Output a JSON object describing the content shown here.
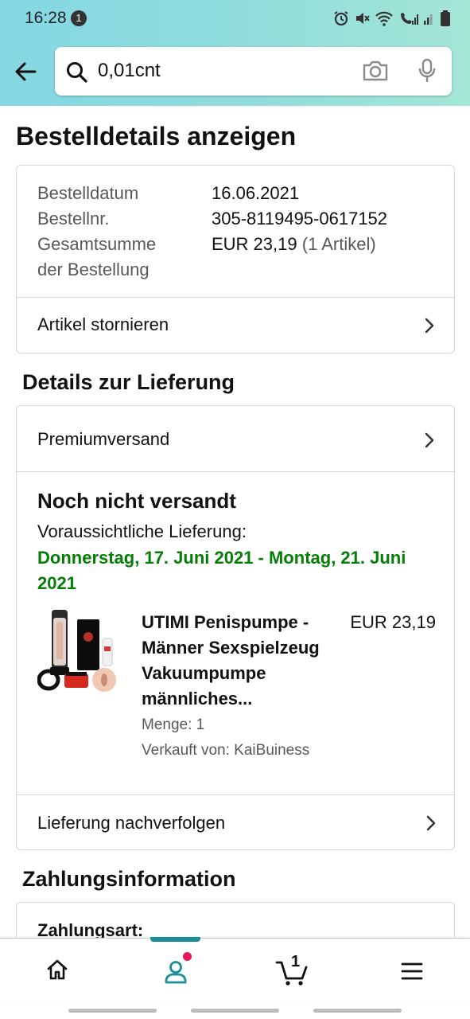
{
  "status_bar": {
    "time": "16:28",
    "notification_count": "1"
  },
  "search": {
    "query": "0,01cnt"
  },
  "page_title": "Bestelldetails anzeigen",
  "order_summary": {
    "date_label": "Bestelldatum",
    "date_value": "16.06.2021",
    "number_label": "Bestellnr.",
    "number_value": "305-8119495-0617152",
    "total_label_line1": "Gesamtsumme",
    "total_label_line2": "der Bestellung",
    "total_value": "EUR 23,19",
    "total_items": "(1 Artikel)",
    "cancel_label": "Artikel stornieren"
  },
  "delivery": {
    "section_title": "Details zur Lieferung",
    "shipping_method": "Premiumversand",
    "status": "Noch nicht versandt",
    "eta_label": "Voraussichtliche Lieferung:",
    "eta_date": "Donnerstag, 17. Juni 2021 - Montag, 21. Juni 2021",
    "product": {
      "title": "UTIMI Penispumpe - Männer Sexspielzeug Vakuumpumpe männliches...",
      "price": "EUR 23,19",
      "quantity": "Menge: 1",
      "seller": "Verkauft von: KaiBuiness"
    },
    "track_label": "Lieferung nachverfolgen"
  },
  "payment": {
    "section_title": "Zahlungsinformation",
    "method_label": "Zahlungsart:"
  },
  "bottom_nav": {
    "cart_count": "1",
    "active_item": "account",
    "accent": "#1a8e99",
    "dot_color": "#e4185b"
  },
  "colors": {
    "eta_green": "#067d06",
    "header_gradient_start": "#84d8e3",
    "header_gradient_end": "#a4e6d6"
  }
}
